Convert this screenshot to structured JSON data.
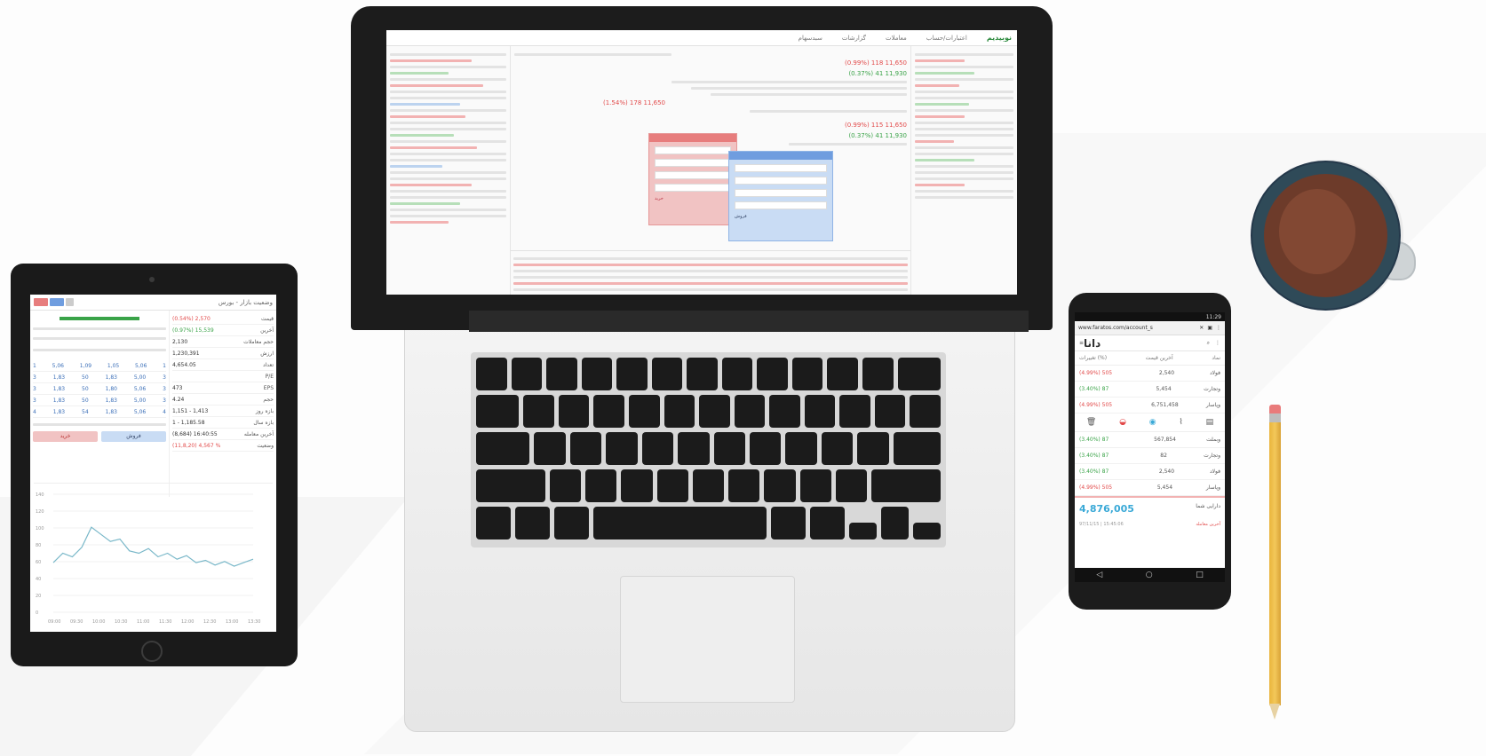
{
  "laptop": {
    "top_logo": "نوبیدیم",
    "top_nav": [
      "اعتبارات/حساب",
      "معاملات",
      "گزارشات",
      "سبدسهام"
    ],
    "prices": [
      {
        "text": "(0.99%) 118  11,650",
        "tone": "red"
      },
      {
        "text": "(0.37%) 41  11,930",
        "tone": "green"
      },
      {
        "text": "(1.54%) 178  11,650",
        "tone": "red"
      },
      {
        "text": "(0.99%) 115  11,650",
        "tone": "red"
      },
      {
        "text": "(0.37%) 41  11,930",
        "tone": "green"
      }
    ],
    "dialog_red_label": "خرید",
    "dialog_blue_label": "فروش"
  },
  "tablet": {
    "title": "وضعیت بازار - بورس",
    "left_grid": [
      [
        "1",
        "5,06",
        "1,09",
        "1,05",
        "5,06",
        "1"
      ],
      [
        "3",
        "1,83",
        "50",
        "1,83",
        "5,00",
        "3"
      ],
      [
        "3",
        "1,83",
        "50",
        "1,80",
        "5,06",
        "3"
      ],
      [
        "3",
        "1,83",
        "50",
        "1,83",
        "5,00",
        "3"
      ],
      [
        "4",
        "1,83",
        "54",
        "1,83",
        "5,06",
        "4"
      ]
    ],
    "right_rows": [
      {
        "label": "قیمت",
        "value": "(0.54%) 2,570",
        "tone": "red"
      },
      {
        "label": "آخرین",
        "value": "(0.97%) 15,539",
        "tone": "green"
      },
      {
        "label": "حجم معاملات",
        "value": "2,130",
        "tone": "plain"
      },
      {
        "label": "ارزش",
        "value": "1,230,391",
        "tone": "plain"
      },
      {
        "label": "تعداد",
        "value": "4,654.05",
        "tone": "plain"
      },
      {
        "label": "P/E",
        "value": "",
        "tone": "plain"
      },
      {
        "label": "EPS",
        "value": "473",
        "tone": "plain"
      },
      {
        "label": "حجم",
        "value": "4.24",
        "tone": "plain"
      },
      {
        "label": "بازه روز",
        "value": "1,151 - 1,413",
        "tone": "plain"
      },
      {
        "label": "بازه سال",
        "value": "1 - 1,185.58",
        "tone": "plain"
      },
      {
        "label": "آخرین معامله",
        "value": "(8,684) 16:40:55",
        "tone": "plain"
      },
      {
        "label": "وضعیت",
        "value": "(11,8,20) 4,567 %",
        "tone": "red"
      }
    ],
    "buy_label": "خرید",
    "sell_label": "فروش",
    "chart_y_labels": [
      "140",
      "120",
      "100",
      "80",
      "60",
      "40",
      "20",
      "0"
    ],
    "chart_x_labels": [
      "09:00",
      "09:30",
      "10:00",
      "10:30",
      "11:00",
      "11:30",
      "12:00",
      "12:30",
      "13:00",
      "13:30"
    ],
    "tag_colors": [
      "#e77d7d",
      "#6f9ddf",
      "#cccccc"
    ]
  },
  "phone": {
    "status": "11:29",
    "url": "www.faratos.com/account_s",
    "logo": "دانا",
    "headers": [
      "نماد",
      "آخرین قیمت",
      "تغییرات (%)"
    ],
    "rows": [
      {
        "symbol": "فولاد",
        "price": "2,540",
        "change": "(4.99%) 505",
        "tone": "red"
      },
      {
        "symbol": "وتجارت",
        "price": "5,454",
        "change": "(3.40%) 87",
        "tone": "green"
      },
      {
        "symbol": "وپاسار",
        "price": "6,751,458",
        "change": "(4.99%) 505",
        "tone": "red"
      }
    ],
    "rows2": [
      {
        "symbol": "وبملت",
        "price": "567,854",
        "change": "(3.40%) 87",
        "tone": "green"
      },
      {
        "symbol": "وتجارت",
        "price": "82",
        "change": "(3.40%) 87",
        "tone": "green"
      },
      {
        "symbol": "فولاد",
        "price": "2,540",
        "change": "(3.40%) 87",
        "tone": "green"
      },
      {
        "symbol": "وپاسار",
        "price": "5,454",
        "change": "(4.99%) 505",
        "tone": "red"
      }
    ],
    "total_label": "دارایی شما",
    "total_value": "4,876,005",
    "footer_left": "97/11/15 | 15:45:06",
    "footer_right": "آخرین معامله"
  }
}
